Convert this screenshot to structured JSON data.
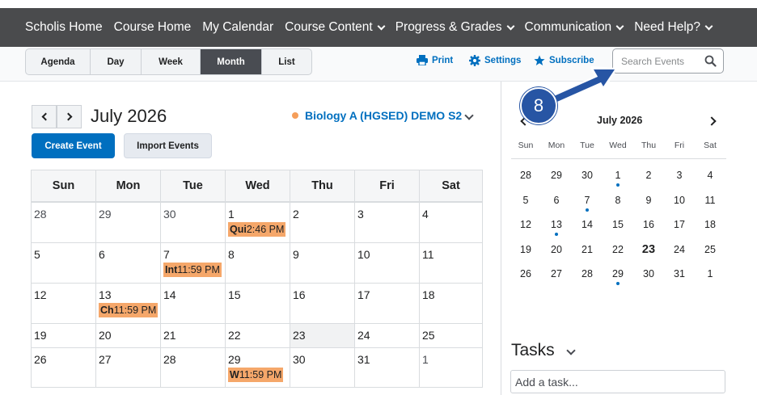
{
  "nav": {
    "items": [
      {
        "label": "Scholis Home",
        "dropdown": false
      },
      {
        "label": "Course Home",
        "dropdown": false
      },
      {
        "label": "My Calendar",
        "dropdown": false
      },
      {
        "label": "Course Content",
        "dropdown": true
      },
      {
        "label": "Progress & Grades",
        "dropdown": true
      },
      {
        "label": "Communication",
        "dropdown": true
      },
      {
        "label": "Need Help?",
        "dropdown": true
      }
    ]
  },
  "toolbar": {
    "views": [
      "Agenda",
      "Day",
      "Week",
      "Month",
      "List"
    ],
    "active_view": "Month",
    "print_label": "Print",
    "settings_label": "Settings",
    "subscribe_label": "Subscribe",
    "search_placeholder": "Search Events"
  },
  "calendar": {
    "month_title": "July 2026",
    "course_name": "Biology A (HGSED) DEMO S2",
    "create_label": "Create Event",
    "import_label": "Import Events",
    "day_headers": [
      "Sun",
      "Mon",
      "Tue",
      "Wed",
      "Thu",
      "Fri",
      "Sat"
    ],
    "weeks": [
      [
        {
          "d": "28",
          "o": true
        },
        {
          "d": "29",
          "o": true
        },
        {
          "d": "30",
          "o": true
        },
        {
          "d": "1",
          "evb": "Qui",
          "evt": "2:46 PM"
        },
        {
          "d": "2"
        },
        {
          "d": "3"
        },
        {
          "d": "4"
        }
      ],
      [
        {
          "d": "5"
        },
        {
          "d": "6"
        },
        {
          "d": "7",
          "evb": "Int",
          "evt": "11:59 PM"
        },
        {
          "d": "8"
        },
        {
          "d": "9"
        },
        {
          "d": "10"
        },
        {
          "d": "11"
        }
      ],
      [
        {
          "d": "12"
        },
        {
          "d": "13",
          "evb": "Ch",
          "evt": "11:59 PM"
        },
        {
          "d": "14"
        },
        {
          "d": "15"
        },
        {
          "d": "16"
        },
        {
          "d": "17"
        },
        {
          "d": "18"
        }
      ],
      [
        {
          "d": "19"
        },
        {
          "d": "20"
        },
        {
          "d": "21"
        },
        {
          "d": "22"
        },
        {
          "d": "23",
          "today": true
        },
        {
          "d": "24"
        },
        {
          "d": "25"
        }
      ],
      [
        {
          "d": "26"
        },
        {
          "d": "27"
        },
        {
          "d": "28"
        },
        {
          "d": "29",
          "evb": "W",
          "evt": "11:59 PM"
        },
        {
          "d": "30"
        },
        {
          "d": "31"
        },
        {
          "d": "1",
          "o": true
        }
      ]
    ]
  },
  "mini": {
    "title": "July 2026",
    "dow": [
      "Sun",
      "Mon",
      "Tue",
      "Wed",
      "Thu",
      "Fri",
      "Sat"
    ],
    "weeks": [
      [
        {
          "d": "28"
        },
        {
          "d": "29"
        },
        {
          "d": "30"
        },
        {
          "d": "1",
          "dot": true
        },
        {
          "d": "2"
        },
        {
          "d": "3"
        },
        {
          "d": "4"
        }
      ],
      [
        {
          "d": "5"
        },
        {
          "d": "6"
        },
        {
          "d": "7",
          "dot": true
        },
        {
          "d": "8"
        },
        {
          "d": "9"
        },
        {
          "d": "10"
        },
        {
          "d": "11"
        }
      ],
      [
        {
          "d": "12"
        },
        {
          "d": "13",
          "dot": true
        },
        {
          "d": "14"
        },
        {
          "d": "15"
        },
        {
          "d": "16"
        },
        {
          "d": "17"
        },
        {
          "d": "18"
        }
      ],
      [
        {
          "d": "19"
        },
        {
          "d": "20"
        },
        {
          "d": "21"
        },
        {
          "d": "22"
        },
        {
          "d": "23",
          "bold": true
        },
        {
          "d": "24"
        },
        {
          "d": "25"
        }
      ],
      [
        {
          "d": "26"
        },
        {
          "d": "27"
        },
        {
          "d": "28"
        },
        {
          "d": "29",
          "dot": true
        },
        {
          "d": "30"
        },
        {
          "d": "31"
        },
        {
          "d": "1"
        }
      ]
    ]
  },
  "tasks": {
    "title": "Tasks",
    "placeholder": "Add a task..."
  },
  "callout": {
    "number": "8"
  },
  "colors": {
    "accent": "#006fbf",
    "nav_bg": "#4a4b4d",
    "event_bg": "#f5a76a",
    "callout": "#2755a4"
  }
}
